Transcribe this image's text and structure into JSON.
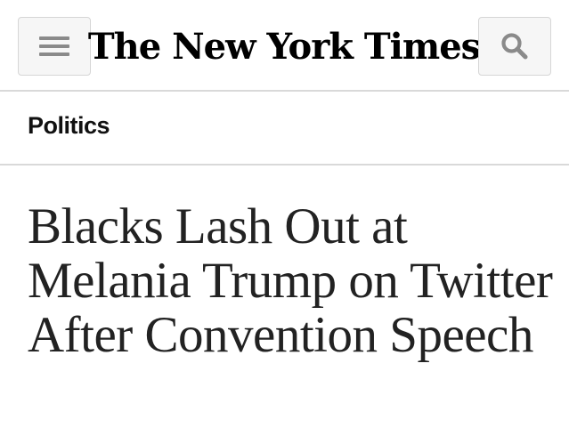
{
  "header": {
    "masthead": "The New York Times",
    "menu_icon": "hamburger-menu-icon",
    "search_icon": "search-icon"
  },
  "section": {
    "label": "Politics"
  },
  "article": {
    "headline": "Blacks Lash Out at Melania Trump on Twitter After Convention Speech"
  },
  "colors": {
    "background": "#ffffff",
    "button_background": "#f6f6f6",
    "button_border": "#d6d6d6",
    "icon_gray": "#8a8a8a",
    "divider": "#d9d9d9",
    "text": "#222222"
  }
}
